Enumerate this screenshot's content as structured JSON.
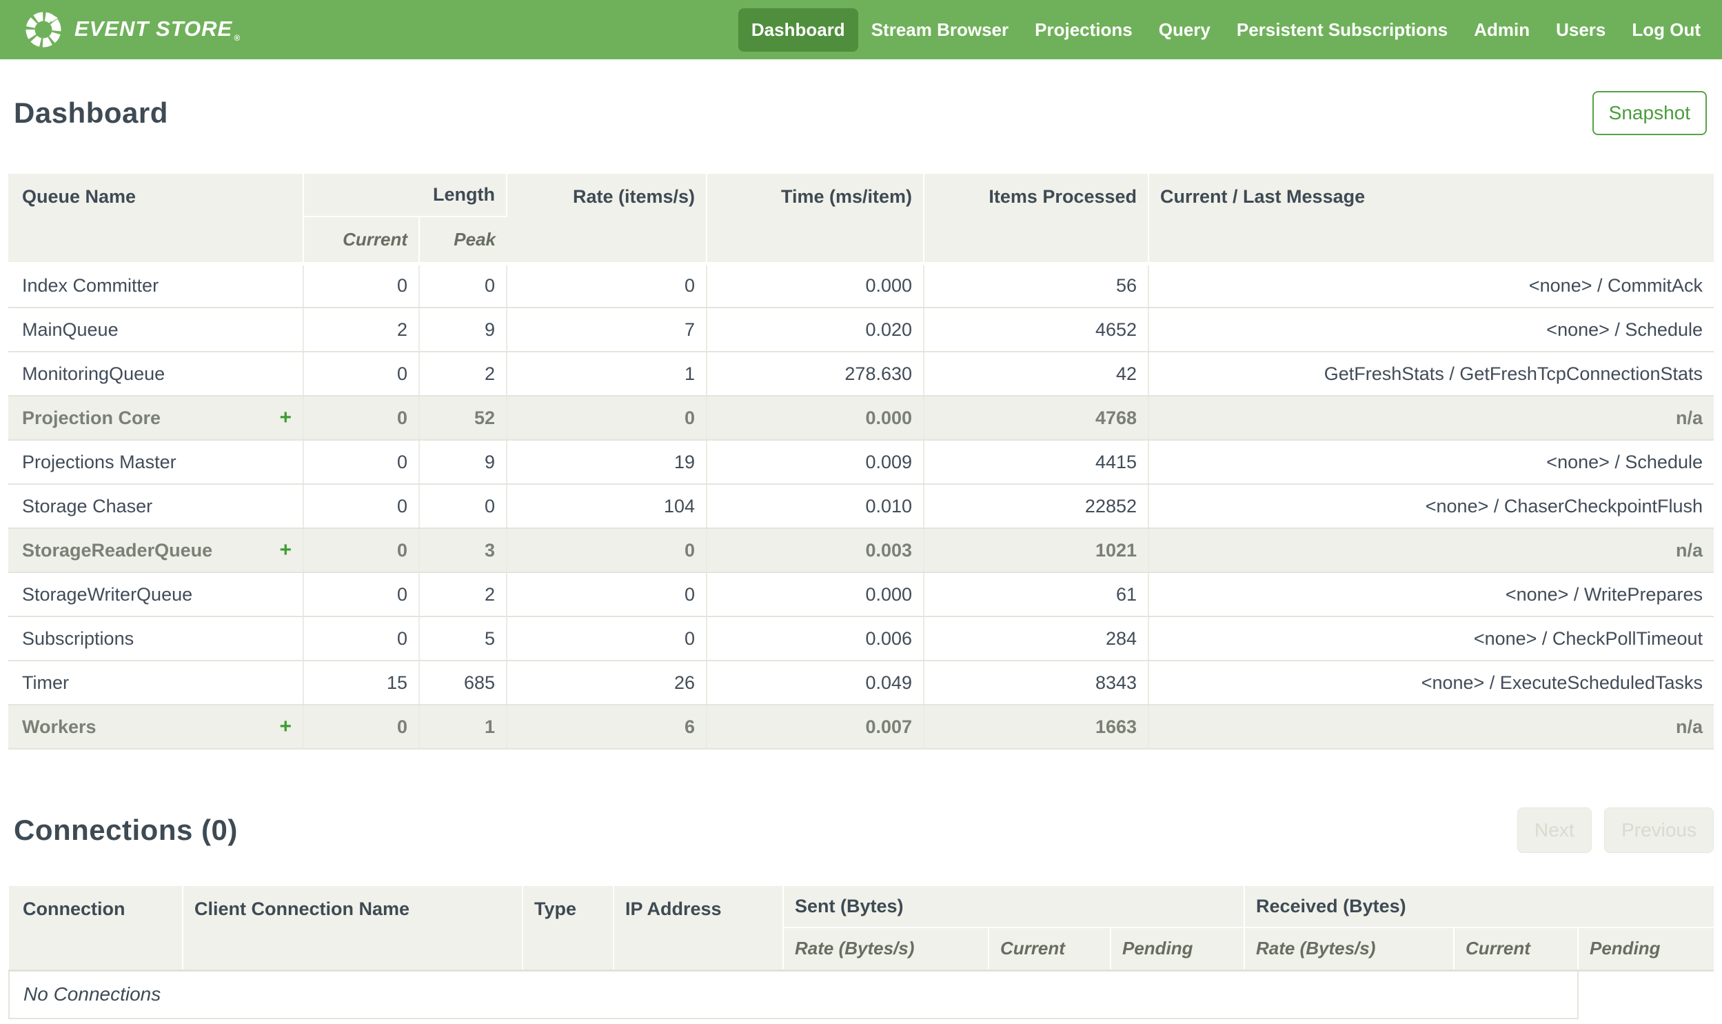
{
  "nav": {
    "brand": "EVENT STORE",
    "brand_reg": "®",
    "items": [
      {
        "label": "Dashboard",
        "active": true
      },
      {
        "label": "Stream Browser",
        "active": false
      },
      {
        "label": "Projections",
        "active": false
      },
      {
        "label": "Query",
        "active": false
      },
      {
        "label": "Persistent Subscriptions",
        "active": false
      },
      {
        "label": "Admin",
        "active": false
      },
      {
        "label": "Users",
        "active": false
      },
      {
        "label": "Log Out",
        "active": false
      }
    ]
  },
  "page": {
    "title": "Dashboard",
    "snapshot_button": "Snapshot"
  },
  "queues": {
    "headers": {
      "queue_name": "Queue Name",
      "length": "Length",
      "current": "Current",
      "peak": "Peak",
      "rate": "Rate (items/s)",
      "time": "Time (ms/item)",
      "items_processed": "Items Processed",
      "message": "Current / Last Message"
    },
    "rows": [
      {
        "name": "Index Committer",
        "expandable": false,
        "group": false,
        "current": "0",
        "peak": "0",
        "rate": "0",
        "time": "0.000",
        "items": "56",
        "message": "<none> / CommitAck"
      },
      {
        "name": "MainQueue",
        "expandable": false,
        "group": false,
        "current": "2",
        "peak": "9",
        "rate": "7",
        "time": "0.020",
        "items": "4652",
        "message": "<none> / Schedule"
      },
      {
        "name": "MonitoringQueue",
        "expandable": false,
        "group": false,
        "current": "0",
        "peak": "2",
        "rate": "1",
        "time": "278.630",
        "items": "42",
        "message": "GetFreshStats / GetFreshTcpConnectionStats"
      },
      {
        "name": "Projection Core",
        "expandable": true,
        "group": true,
        "current": "0",
        "peak": "52",
        "rate": "0",
        "time": "0.000",
        "items": "4768",
        "message": "n/a"
      },
      {
        "name": "Projections Master",
        "expandable": false,
        "group": false,
        "current": "0",
        "peak": "9",
        "rate": "19",
        "time": "0.009",
        "items": "4415",
        "message": "<none> / Schedule"
      },
      {
        "name": "Storage Chaser",
        "expandable": false,
        "group": false,
        "current": "0",
        "peak": "0",
        "rate": "104",
        "time": "0.010",
        "items": "22852",
        "message": "<none> / ChaserCheckpointFlush"
      },
      {
        "name": "StorageReaderQueue",
        "expandable": true,
        "group": true,
        "current": "0",
        "peak": "3",
        "rate": "0",
        "time": "0.003",
        "items": "1021",
        "message": "n/a"
      },
      {
        "name": "StorageWriterQueue",
        "expandable": false,
        "group": false,
        "current": "0",
        "peak": "2",
        "rate": "0",
        "time": "0.000",
        "items": "61",
        "message": "<none> / WritePrepares"
      },
      {
        "name": "Subscriptions",
        "expandable": false,
        "group": false,
        "current": "0",
        "peak": "5",
        "rate": "0",
        "time": "0.006",
        "items": "284",
        "message": "<none> / CheckPollTimeout"
      },
      {
        "name": "Timer",
        "expandable": false,
        "group": false,
        "current": "15",
        "peak": "685",
        "rate": "26",
        "time": "0.049",
        "items": "8343",
        "message": "<none> / ExecuteScheduledTasks"
      },
      {
        "name": "Workers",
        "expandable": true,
        "group": true,
        "current": "0",
        "peak": "1",
        "rate": "6",
        "time": "0.007",
        "items": "1663",
        "message": "n/a"
      }
    ],
    "expand_icon": "+"
  },
  "connections": {
    "title": "Connections (0)",
    "next_button": "Next",
    "previous_button": "Previous",
    "headers": {
      "connection": "Connection",
      "client_connection_name": "Client Connection Name",
      "type": "Type",
      "ip_address": "IP Address",
      "sent": "Sent (Bytes)",
      "received": "Received (Bytes)",
      "rate_sub": "Rate (Bytes/s)",
      "current_sub": "Current",
      "pending_sub": "Pending"
    },
    "empty_message": "No Connections"
  },
  "colors": {
    "nav_green": "#6fb15a",
    "nav_active_green": "#4f8e3d",
    "accent_green": "#3f9e33",
    "button_green": "#4a9c3c",
    "heading_text": "#3e4a54",
    "table_text": "#414c58",
    "group_text": "#7b8076",
    "header_bg": "#f0f1ea",
    "group_row_bg": "#eef0e9",
    "disabled_text": "#d9dbd0"
  }
}
